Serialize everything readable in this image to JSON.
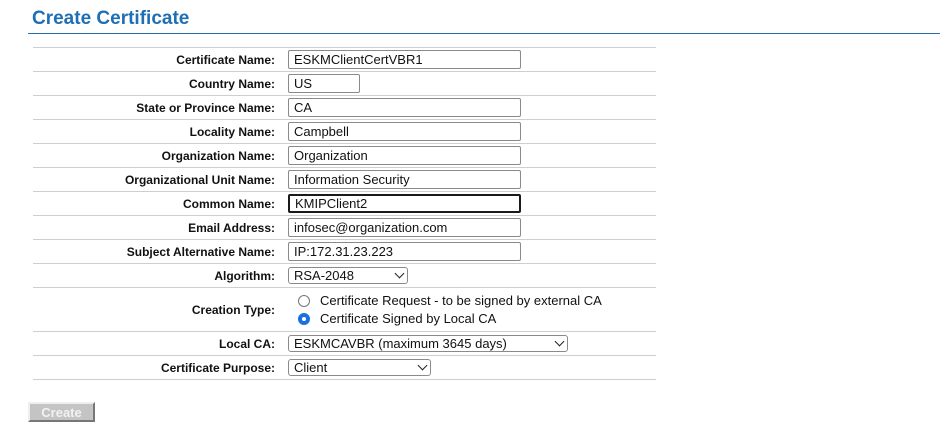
{
  "title": "Create Certificate",
  "fields": {
    "certificate_name": {
      "label": "Certificate Name:",
      "value": "ESKMClientCertVBR1"
    },
    "country_name": {
      "label": "Country Name:",
      "value": "US"
    },
    "state": {
      "label": "State or Province Name:",
      "value": "CA"
    },
    "locality": {
      "label": "Locality Name:",
      "value": "Campbell"
    },
    "organization": {
      "label": "Organization Name:",
      "value": "Organization"
    },
    "org_unit": {
      "label": "Organizational Unit Name:",
      "value": "Information Security"
    },
    "common_name": {
      "label": "Common Name:",
      "value": "KMIPClient2"
    },
    "email": {
      "label": "Email Address:",
      "value": "infosec@organization.com"
    },
    "san": {
      "label": "Subject Alternative Name:",
      "value": "IP:172.31.23.223"
    }
  },
  "algorithm": {
    "label": "Algorithm:",
    "selected": "RSA-2048"
  },
  "creation_type": {
    "label": "Creation Type:",
    "options": [
      {
        "label": "Certificate Request - to be signed by external CA",
        "checked": false
      },
      {
        "label": "Certificate Signed by Local CA",
        "checked": true
      }
    ]
  },
  "local_ca": {
    "label": "Local CA:",
    "selected": "ESKMCAVBR (maximum 3645 days)"
  },
  "certificate_purpose": {
    "label": "Certificate Purpose:",
    "selected": "Client"
  },
  "create_button": "Create",
  "colors": {
    "title": "#1f6fb5",
    "radio_accent": "#1b6fe0",
    "button_bg": "#c4c4c4"
  }
}
